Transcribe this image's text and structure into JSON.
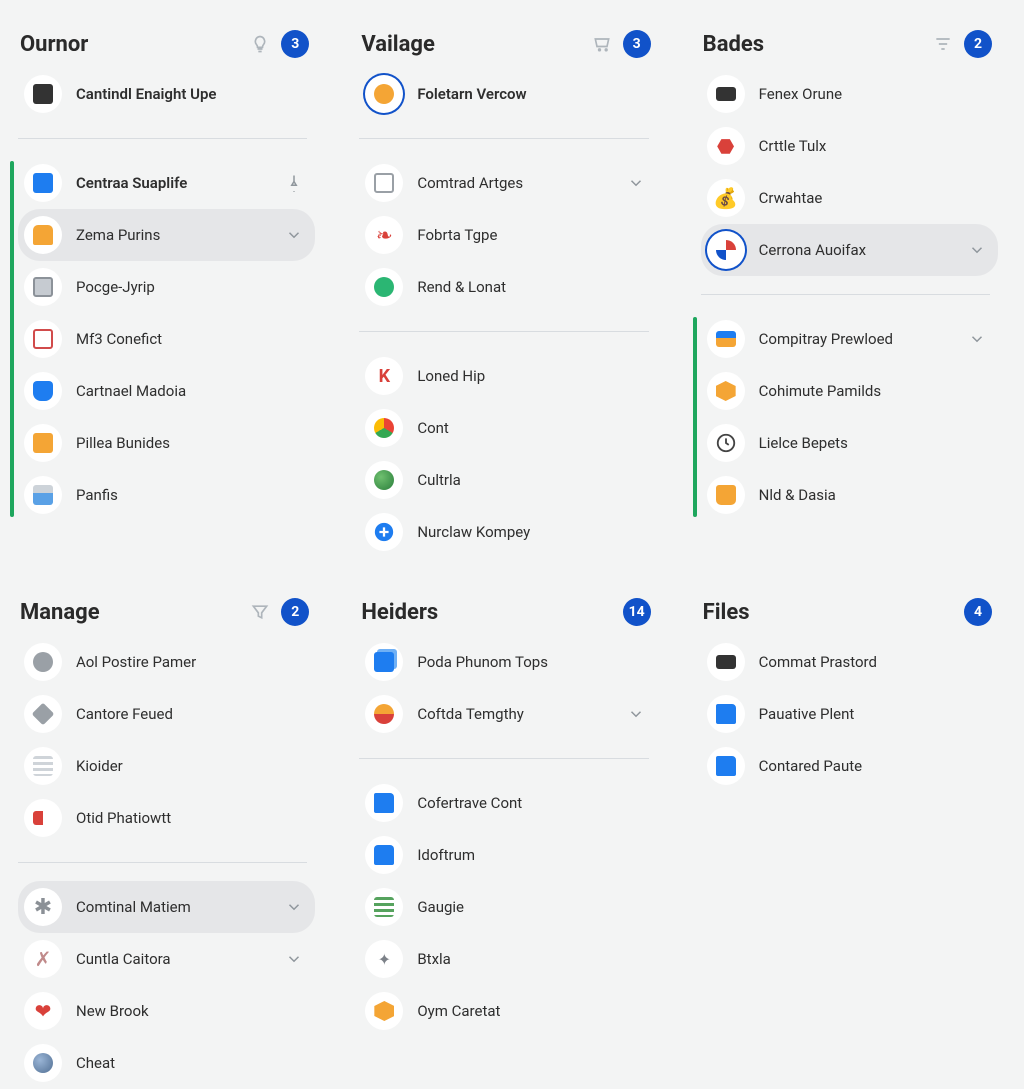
{
  "panels": {
    "ournor": {
      "title": "Ournor",
      "badge": 3,
      "groups": [
        {
          "items": [
            {
              "label": "Cantindl Enaight Upe"
            }
          ]
        },
        {
          "accent": true,
          "items": [
            {
              "label": "Centraa Suaplife",
              "trail": "pin"
            },
            {
              "label": "Zema Purins",
              "selected": true,
              "trail": "chevron"
            },
            {
              "label": "Pocge-Jyrip"
            },
            {
              "label": "Mf3 Conefict"
            },
            {
              "label": "Cartnael Madoia"
            },
            {
              "label": "Pillea Bunides"
            },
            {
              "label": "Panfis"
            }
          ]
        }
      ]
    },
    "vailage": {
      "title": "Vailage",
      "badge": 3,
      "groups": [
        {
          "items": [
            {
              "label": "Foletarn Vercow",
              "ring": true
            }
          ]
        },
        {
          "items": [
            {
              "label": "Comtrad Artges",
              "trail": "chevron"
            },
            {
              "label": "Fobrta Tgpe"
            },
            {
              "label": "Rend & Lonat"
            }
          ]
        },
        {
          "items": [
            {
              "label": "Loned Hip"
            },
            {
              "label": "Cont"
            },
            {
              "label": "Cultrla"
            },
            {
              "label": "Nurclaw Kompey"
            }
          ]
        }
      ]
    },
    "bades": {
      "title": "Bades",
      "badge": 2,
      "groups": [
        {
          "items": [
            {
              "label": "Fenex Orune"
            },
            {
              "label": "Crttle Tulx"
            },
            {
              "label": "Crwahtae"
            },
            {
              "label": "Cerrona Auoifax",
              "selected": true,
              "ring": true,
              "trail": "chevron"
            }
          ]
        },
        {
          "accent": true,
          "items": [
            {
              "label": "Compitray Prewloed",
              "trail": "chevron"
            },
            {
              "label": "Cohimute Pamilds"
            },
            {
              "label": "Lielce Bepets"
            },
            {
              "label": "Nld & Dasia"
            }
          ]
        }
      ]
    },
    "manage": {
      "title": "Manage",
      "badge": 2,
      "groups": [
        {
          "items": [
            {
              "label": "Aol Postire Pamer"
            },
            {
              "label": "Cantore Feued"
            },
            {
              "label": "Kioider"
            },
            {
              "label": "Otid Phatiowtt"
            }
          ]
        },
        {
          "items": [
            {
              "label": "Comtinal Matiem",
              "selected": true,
              "trail": "chevron"
            },
            {
              "label": "Cuntla Caitora",
              "trail": "chevron"
            },
            {
              "label": "New Brook"
            },
            {
              "label": "Cheat"
            }
          ]
        }
      ]
    },
    "heiders": {
      "title": "Heiders",
      "badge": 14,
      "groups": [
        {
          "items": [
            {
              "label": "Poda Phunom Tops"
            },
            {
              "label": "Coftda Temgthy",
              "trail": "chevron"
            }
          ]
        },
        {
          "items": [
            {
              "label": "Cofertrave Cont"
            },
            {
              "label": "Idoftrum"
            },
            {
              "label": "Gaugie"
            },
            {
              "label": "Btxla"
            },
            {
              "label": "Oym Caretat"
            }
          ]
        }
      ]
    },
    "files": {
      "title": "Files",
      "badge": 4,
      "groups": [
        {
          "items": [
            {
              "label": "Commat Prastord"
            },
            {
              "label": "Pauative Plent"
            },
            {
              "label": "Contared Paute"
            }
          ]
        }
      ]
    }
  }
}
